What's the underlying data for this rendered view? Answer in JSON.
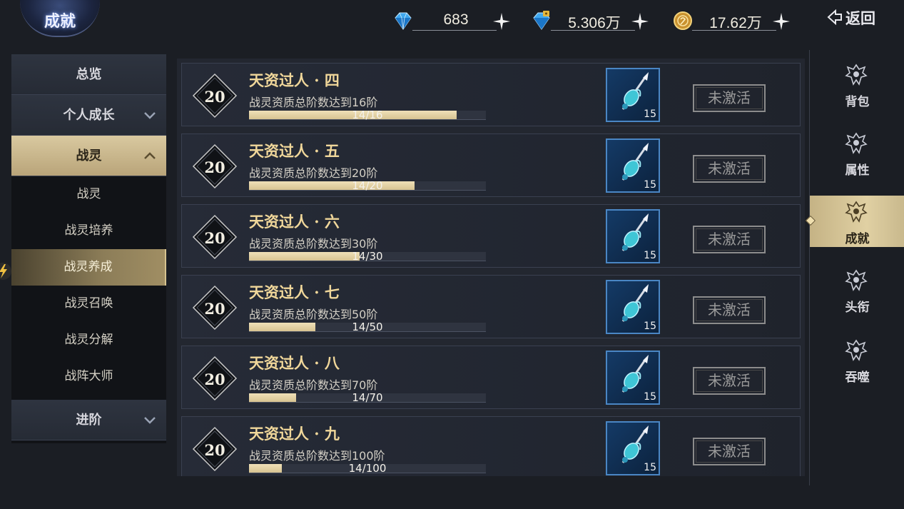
{
  "header": {
    "emblem_title": "成就",
    "currencies": [
      {
        "icon": "diamond-icon",
        "value": "683"
      },
      {
        "icon": "bound-diamond-icon",
        "value": "5.306万"
      },
      {
        "icon": "gold-coin-icon",
        "value": "17.62万"
      }
    ],
    "back_label": "返回"
  },
  "left_nav": {
    "categories": [
      {
        "label": "总览"
      },
      {
        "label": "个人成长"
      },
      {
        "label": "战灵"
      }
    ],
    "sub_items": [
      {
        "label": "战灵"
      },
      {
        "label": "战灵培养"
      },
      {
        "label": "战灵养成"
      },
      {
        "label": "战灵召唤"
      },
      {
        "label": "战灵分解"
      },
      {
        "label": "战阵大师"
      }
    ],
    "bottom_category": {
      "label": "进阶"
    },
    "active_sub": "战灵养成"
  },
  "achievements": [
    {
      "points": "20",
      "title": "天资过人 · 四",
      "desc": "战灵资质总阶数达到16阶",
      "progress_text": "14/16",
      "progress": 0.875,
      "reward_qty": "15",
      "status": "未激活"
    },
    {
      "points": "20",
      "title": "天资过人 · 五",
      "desc": "战灵资质总阶数达到20阶",
      "progress_text": "14/20",
      "progress": 0.7,
      "reward_qty": "15",
      "status": "未激活"
    },
    {
      "points": "20",
      "title": "天资过人 · 六",
      "desc": "战灵资质总阶数达到30阶",
      "progress_text": "14/30",
      "progress": 0.467,
      "reward_qty": "15",
      "status": "未激活"
    },
    {
      "points": "20",
      "title": "天资过人 · 七",
      "desc": "战灵资质总阶数达到50阶",
      "progress_text": "14/50",
      "progress": 0.28,
      "reward_qty": "15",
      "status": "未激活"
    },
    {
      "points": "20",
      "title": "天资过人 · 八",
      "desc": "战灵资质总阶数达到70阶",
      "progress_text": "14/70",
      "progress": 0.2,
      "reward_qty": "15",
      "status": "未激活"
    },
    {
      "points": "20",
      "title": "天资过人 · 九",
      "desc": "战灵资质总阶数达到100阶",
      "progress_text": "14/100",
      "progress": 0.14,
      "reward_qty": "15",
      "status": "未激活"
    }
  ],
  "right_nav": {
    "tabs": [
      {
        "label": "背包",
        "icon": "crest-icon"
      },
      {
        "label": "属性",
        "icon": "crest-icon"
      },
      {
        "label": "成就",
        "icon": "crest-icon"
      },
      {
        "label": "头衔",
        "icon": "crest-icon"
      },
      {
        "label": "吞噬",
        "icon": "crest-icon"
      }
    ],
    "active_tab": "成就"
  },
  "colors": {
    "accent_gold": "#f0d79a",
    "active_tab_bg": "#d9c9a0",
    "reward_border": "#4a86c4",
    "inactive_button": "#9a9a9a"
  }
}
